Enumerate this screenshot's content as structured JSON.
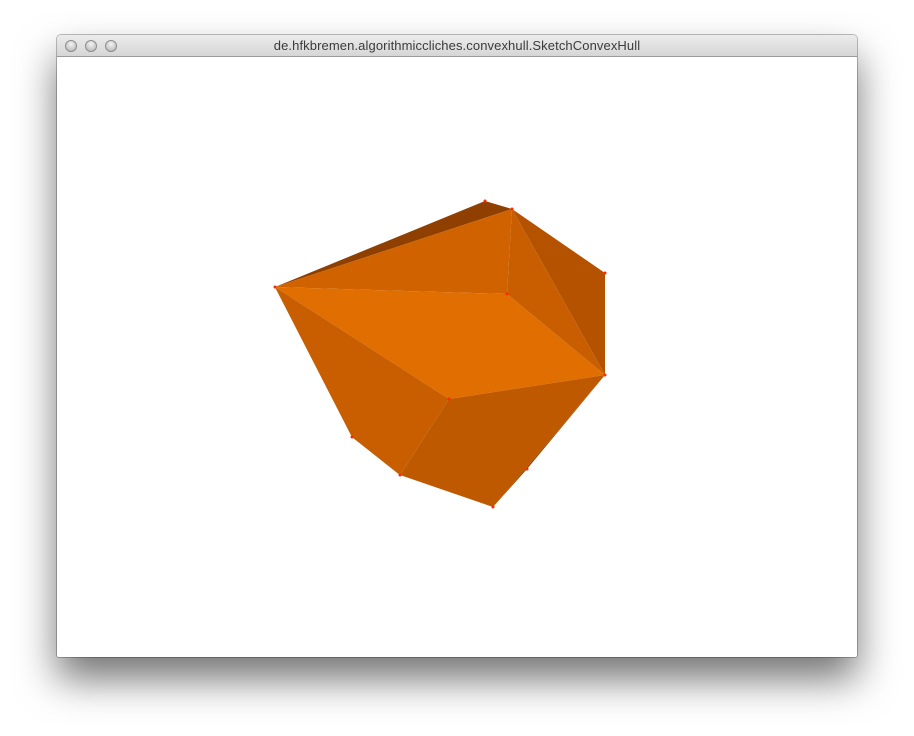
{
  "window": {
    "title": "de.hfkbremen.algorithmiccliches.convexhull.SketchConvexHull",
    "controls": [
      {
        "name": "close",
        "icon": "circle-button-icon"
      },
      {
        "name": "minimize",
        "icon": "circle-button-icon"
      },
      {
        "name": "zoom",
        "icon": "circle-button-icon"
      }
    ]
  },
  "sketch": {
    "content": "3D convex hull polyhedron",
    "fill_colors": [
      "#8f4000",
      "#b45200",
      "#c85e00",
      "#d46600",
      "#e06e00"
    ],
    "vertex_color": "#ff2a00",
    "background": "#ffffff"
  }
}
